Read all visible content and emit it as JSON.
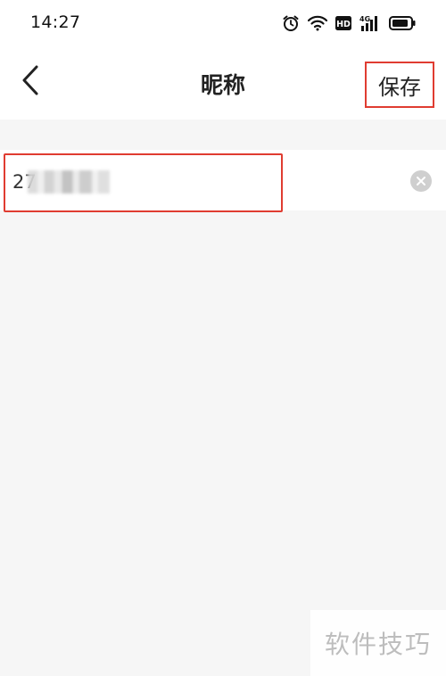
{
  "status_bar": {
    "time": "14:27",
    "icons": [
      "alarm-icon",
      "wifi-icon",
      "hd-icon",
      "signal-4g-icon",
      "battery-icon"
    ],
    "hd_label": "HD",
    "network_label": "4G"
  },
  "header": {
    "back_icon": "chevron-left-icon",
    "title": "昵称",
    "save_label": "保存"
  },
  "nickname_field": {
    "value": "27",
    "clear_icon": "close-circle-icon"
  },
  "watermark": {
    "text": "软件技巧"
  },
  "colors": {
    "highlight": "#e03c31",
    "background": "#f6f6f6",
    "surface": "#ffffff"
  }
}
